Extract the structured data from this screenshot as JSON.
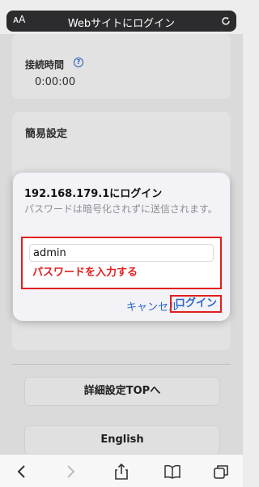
{
  "browser": {
    "reader_label": "ᴀA",
    "page_title": "Webサイトにログイン"
  },
  "page": {
    "connection_time_label": "接続時間",
    "connection_time_value": "0:00:00",
    "easy_settings_label": "簡易設定",
    "details_button": "詳細設定TOPへ",
    "english_button": "English"
  },
  "dialog": {
    "title": "192.168.179.1にログイン",
    "message": "パスワードは暗号化されずに送信されます。",
    "username_value": "admin",
    "password_placeholder": "パスワードを入力する",
    "cancel_label": "キャンセル",
    "login_label": "ログイン"
  },
  "colors": {
    "accent": "#2b66c9",
    "highlight": "#e21e1e"
  }
}
